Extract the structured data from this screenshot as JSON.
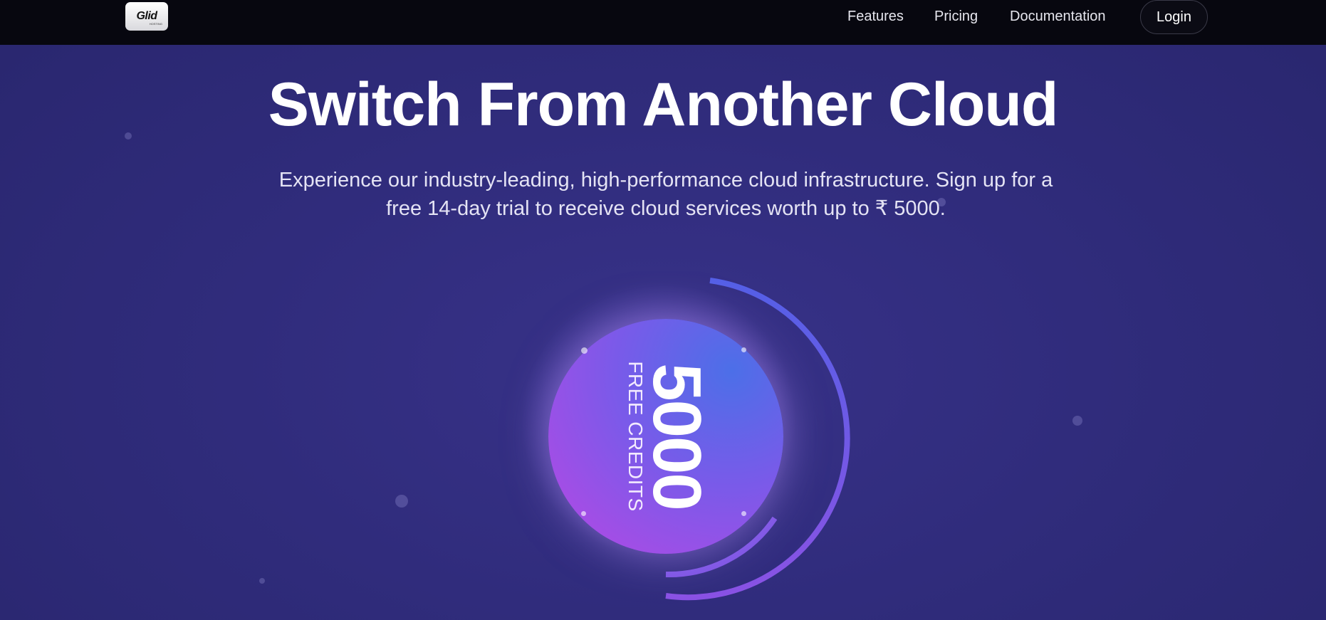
{
  "nav": {
    "logo_text": "Glid",
    "logo_sub": "HOSTING",
    "links": [
      {
        "label": "Features"
      },
      {
        "label": "Pricing"
      },
      {
        "label": "Documentation"
      }
    ],
    "login_label": "Login"
  },
  "hero": {
    "title": "Switch From Another Cloud",
    "subtitle": "Experience our industry-leading, high-performance cloud infrastructure. Sign up for a free 14-day trial to receive cloud services worth up to ₹ 5000."
  },
  "badge": {
    "number": "5000",
    "label": "FREE CREDITS"
  },
  "colors": {
    "nav_bg": "#07070f",
    "page_bg": "#2f2b7a",
    "orb_blue": "#4c6fe8",
    "orb_purple": "#b04ce4",
    "text_white": "#ffffff"
  }
}
